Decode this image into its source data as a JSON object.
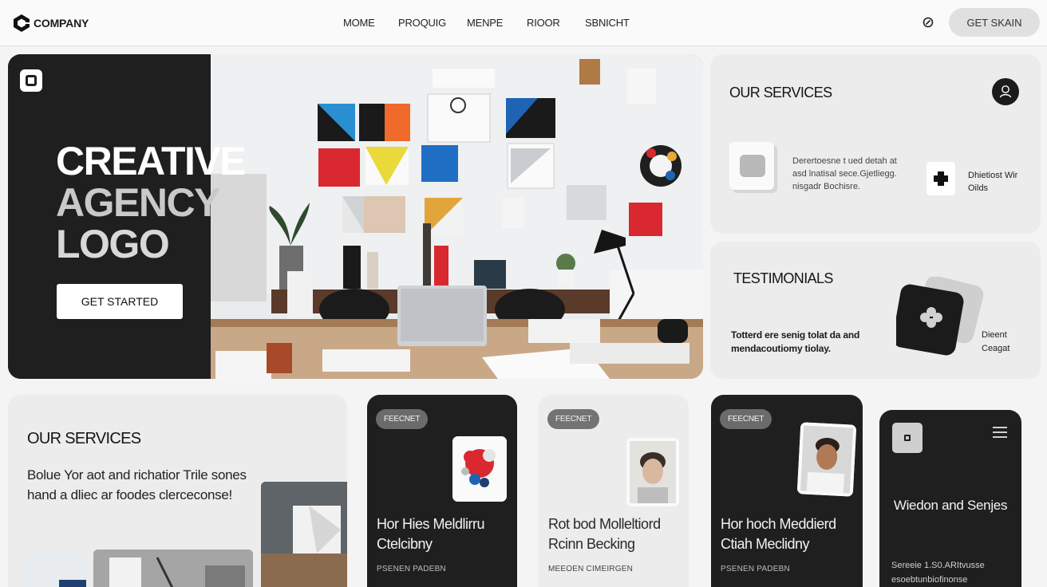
{
  "header": {
    "brand": "COMPANY",
    "nav": [
      "MOME",
      "PROQUIG",
      "MENPE",
      "RIOOR",
      "SBNICHT"
    ],
    "cta_label": "GET SKAIN"
  },
  "hero": {
    "title_lines": [
      "CREATIVE",
      "AGENCY",
      "LOGO"
    ],
    "button_label": "GET STARTED"
  },
  "services_card": {
    "title": "OUR SERVICES",
    "description": "Derertoesne t ued detah at asd lnatisal sece.Gjetliegg. nisgadr Bochisre.",
    "secondary_label": "Dhietiost Wir Oilds"
  },
  "testimonials_card": {
    "title": "TESTIMONIALS",
    "text": "Totterd ere senig tolat da and mendacoutiomy tiolay.",
    "side_label": "Dieent Ceagat"
  },
  "bottom_services": {
    "title": "OUR SERVICES",
    "text": "Bolue Yor aot and richatior Trile sones hand a dliec ar foodes clerceconse!"
  },
  "portfolio_cards": [
    {
      "pill": "FEECNET",
      "title": "Hor Hies Meldlirru Ctelcibny",
      "meta": "PSENEN   PADEBN"
    },
    {
      "pill": "FEECNET",
      "title": "Rot bod Molleltiord Rcinn Becking",
      "meta": "MEEOEN CIMEIRGEN"
    },
    {
      "pill": "FEECNET",
      "title": "Hor hoch Meddierd Ctiah Meclidny",
      "meta": "PSENEN   PADEBN"
    }
  ],
  "menu_card": {
    "title": "Wiedon and Senjes",
    "text": "Sereeie 1.S0.ARItvusse esoebtunbiofinonse"
  },
  "colors": {
    "dark": "#1f1f1f",
    "card_light": "#ececec",
    "accent_red": "#d9282f",
    "accent_blue": "#1f64b4"
  }
}
